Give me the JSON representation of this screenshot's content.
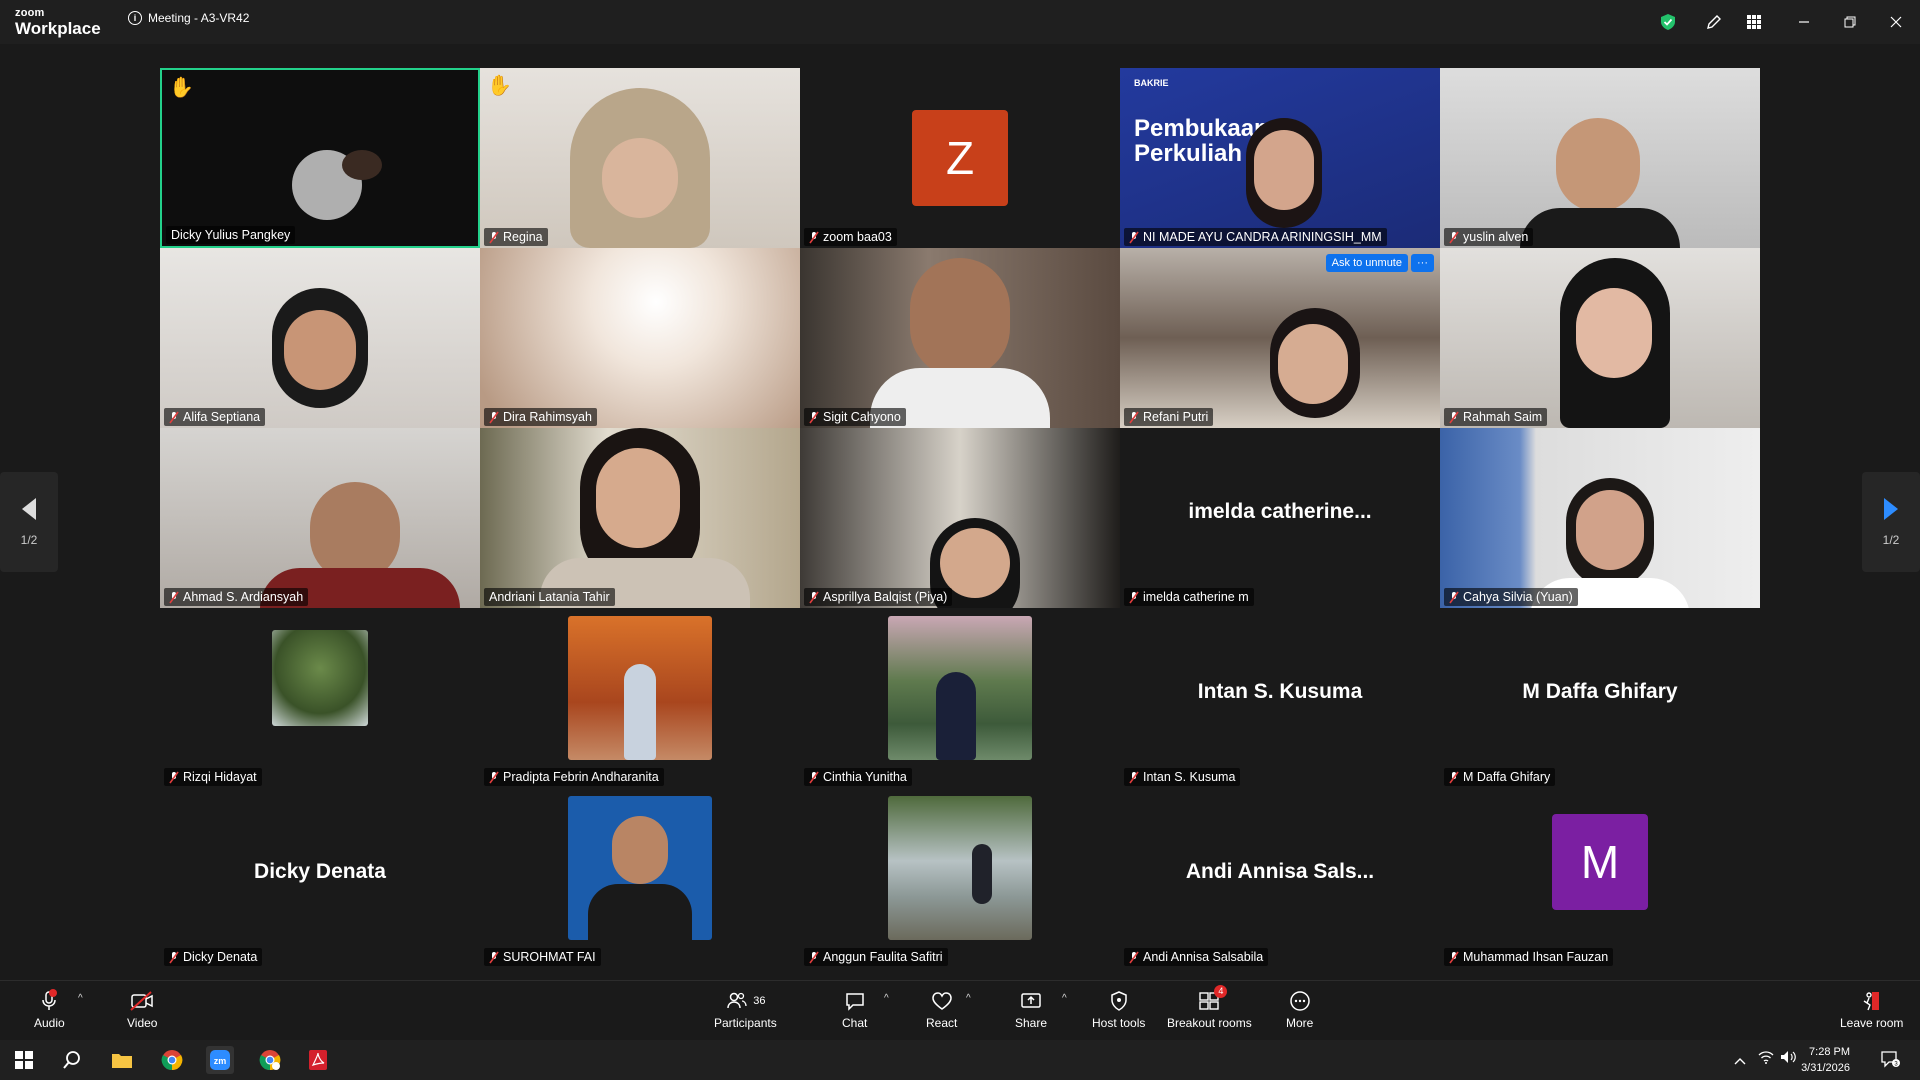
{
  "titlebar": {
    "logo_top": "zoom",
    "logo_bottom": "Workplace",
    "meeting_title": "Meeting - A3-VR42",
    "icons": [
      "shield-check-icon",
      "pencil-icon",
      "apps-grid-icon",
      "minimize-icon",
      "restore-icon",
      "close-icon"
    ]
  },
  "pager": {
    "left": "1/2",
    "right": "1/2"
  },
  "tiles": [
    {
      "name": "Dicky Yulius Pangkey",
      "muted": false,
      "hand": true,
      "active": true
    },
    {
      "name": "Regina",
      "muted": true,
      "hand": true
    },
    {
      "name": "zoom baa03",
      "muted": true,
      "avatar_letter": "Z",
      "avatar_color": "#c8401a"
    },
    {
      "name": "NI MADE AYU CANDRA ARININGSIH_MM",
      "muted": true,
      "slide_title": "Pembukaan Perkuliah",
      "slide_brand": "BAKRIE"
    },
    {
      "name": "yuslin alven",
      "muted": true
    },
    {
      "name": "Alifa Septiana",
      "muted": true
    },
    {
      "name": "Dira Rahimsyah",
      "muted": true
    },
    {
      "name": "Sigit Cahyono",
      "muted": true
    },
    {
      "name": "Refani Putri",
      "muted": true,
      "ask_label": "Ask to unmute",
      "more_label": "···"
    },
    {
      "name": "Rahmah Saim",
      "muted": true
    },
    {
      "name": "Ahmad S. Ardiansyah",
      "muted": true
    },
    {
      "name": "Andriani Latania Tahir",
      "muted": false
    },
    {
      "name": "Asprillya Balqist (Piya)",
      "muted": true
    },
    {
      "name": "imelda catherine m",
      "muted": true,
      "big_name": "imelda  catherine..."
    },
    {
      "name": "Cahya Silvia (Yuan)",
      "muted": true
    },
    {
      "name": "Rizqi Hidayat",
      "muted": true
    },
    {
      "name": "Pradipta Febrin Andharanita",
      "muted": true
    },
    {
      "name": "Cinthia Yunitha",
      "muted": true
    },
    {
      "name": "Intan S. Kusuma",
      "muted": true,
      "big_name": "Intan S. Kusuma"
    },
    {
      "name": "M Daffa Ghifary",
      "muted": true,
      "big_name": "M Daffa Ghifary"
    },
    {
      "name": "Dicky Denata",
      "muted": true,
      "big_name": "Dicky Denata"
    },
    {
      "name": "SUROHMAT FAI",
      "muted": true
    },
    {
      "name": "Anggun Faulita Safitri",
      "muted": true
    },
    {
      "name": "Andi Annisa Salsabila",
      "muted": true,
      "big_name": "Andi  Annisa  Sals..."
    },
    {
      "name": "Muhammad Ihsan Fauzan",
      "muted": true,
      "avatar_letter": "M",
      "avatar_color": "#7b1fa2"
    }
  ],
  "toolbar": {
    "audio": "Audio",
    "video": "Video",
    "participants": "Participants",
    "participants_count": "36",
    "chat": "Chat",
    "react": "React",
    "share": "Share",
    "host_tools": "Host tools",
    "breakout": "Breakout rooms",
    "breakout_badge": "4",
    "more": "More",
    "leave": "Leave room"
  },
  "taskbar": {
    "apps": [
      "windows-start-icon",
      "search-icon",
      "file-explorer-icon",
      "chrome-icon",
      "zoom-icon",
      "chrome-profile-icon",
      "acrobat-icon"
    ],
    "time": "7:28 PM",
    "date": "3/31/2026"
  }
}
